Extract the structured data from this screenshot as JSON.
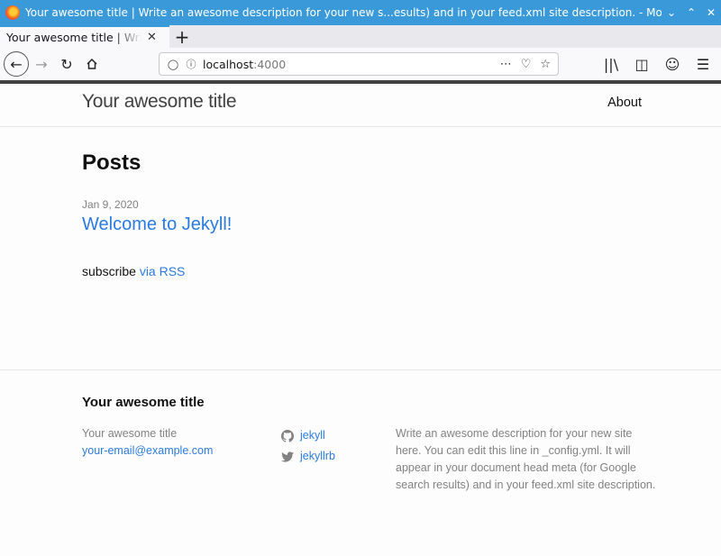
{
  "window": {
    "title": "Your awesome title | Write an awesome description for your new s...esults) and in your feed.xml site description. - Mozilla Firefox"
  },
  "tabs": [
    {
      "label": "Your awesome title | Write an awesome description"
    }
  ],
  "navbar": {
    "url_host": "localhost",
    "url_port": ":4000"
  },
  "site": {
    "title": "Your awesome title",
    "nav": {
      "about": "About"
    }
  },
  "main": {
    "heading": "Posts",
    "posts": [
      {
        "date": "Jan 9, 2020",
        "title": "Welcome to Jekyll!"
      }
    ],
    "subscribe_text": "subscribe",
    "subscribe_link": "via RSS"
  },
  "footer": {
    "heading": "Your awesome title",
    "name": "Your awesome title",
    "email": "your-email@example.com",
    "github": "jekyll",
    "twitter": "jekyllrb",
    "description": "Write an awesome description for your new site here. You can edit this line in _config.yml. It will appear in your document head meta (for Google search results) and in your feed.xml site description."
  },
  "colors": {
    "titlebar": "#3a9ad9",
    "link": "#2a7ae2",
    "meta": "#828282"
  }
}
